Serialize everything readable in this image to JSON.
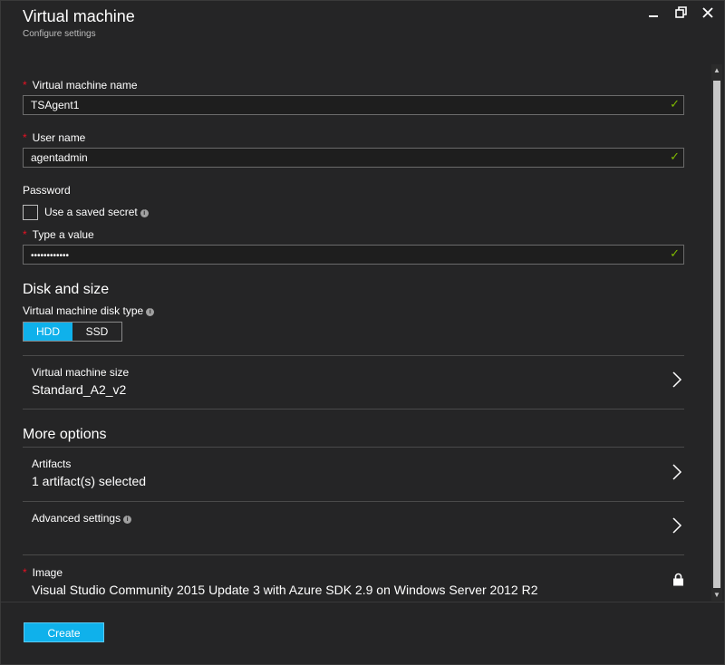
{
  "header": {
    "title": "Virtual machine",
    "subtitle": "Configure settings",
    "controls": [
      "minimize-icon",
      "restore-icon",
      "close-icon"
    ]
  },
  "form": {
    "vm_name": {
      "label": "Virtual machine name",
      "value": "TSAgent1",
      "required": true,
      "valid": true
    },
    "user_name": {
      "label": "User name",
      "value": "agentadmin",
      "required": true,
      "valid": true
    },
    "password": {
      "label": "Password",
      "saved_secret_label": "Use a saved secret",
      "saved_secret_checked": false,
      "type_label": "Type a value",
      "value": "••••••••••••",
      "valid": true
    }
  },
  "disk": {
    "section_title": "Disk and size",
    "type_label": "Virtual machine disk type",
    "options": [
      "HDD",
      "SSD"
    ],
    "selected": "HDD",
    "size_label": "Virtual machine size",
    "size_value": "Standard_A2_v2"
  },
  "more": {
    "section_title": "More options",
    "artifacts_label": "Artifacts",
    "artifacts_value": "1 artifact(s) selected",
    "advanced_label": "Advanced settings",
    "image_label": "Image",
    "image_value": "Visual Studio Community 2015 Update 3 with Azure SDK 2.9 on Windows Server 2012 R2"
  },
  "footer": {
    "create_label": "Create"
  },
  "colors": {
    "accent": "#0fb1eb",
    "valid": "#7fba00",
    "required": "#e81123",
    "background": "#252526"
  }
}
